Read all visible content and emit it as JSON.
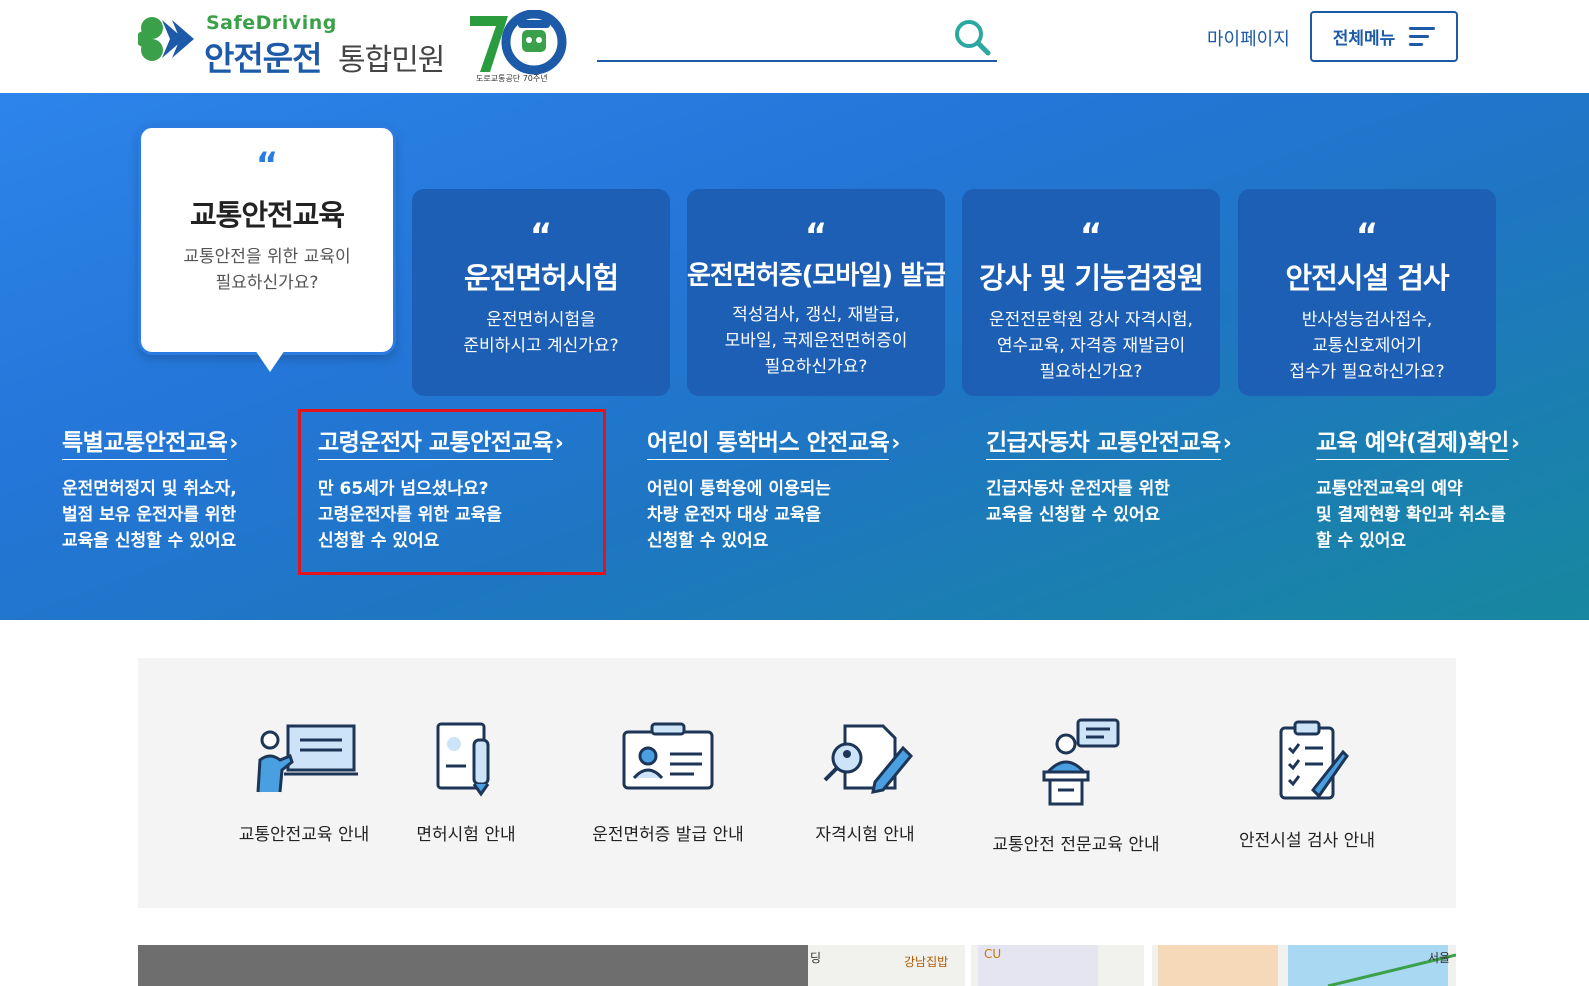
{
  "header": {
    "logo_en": "SafeDriving",
    "logo_ko_main": "안전운전",
    "logo_ko_sub": "통합민원",
    "logo_anniv_sub": "도로교통공단 70주년",
    "search_placeholder": "",
    "mypage_label": "마이페이지",
    "allmenu_label": "전체메뉴"
  },
  "hero": {
    "active_card": {
      "quote": "“",
      "title": "교통안전교육",
      "desc": "교통안전을 위한 교육이\n필요하신가요?"
    },
    "cards": [
      {
        "quote": "“",
        "title": "운전면허시험",
        "desc": "운전면허시험을\n준비하시고 계신가요?"
      },
      {
        "quote": "“",
        "title": "운전면허증(모바일) 발급",
        "desc": "적성검사, 갱신, 재발급,\n모바일, 국제운전면허증이\n필요하신가요?"
      },
      {
        "quote": "“",
        "title": "강사 및 기능검정원",
        "desc": "운전전문학원 강사 자격시험,\n연수교육, 자격증 재발급이\n필요하신가요?"
      },
      {
        "quote": "“",
        "title": "안전시설 검사",
        "desc": "반사성능검사접수,\n교통신호제어기\n접수가 필요하신가요?"
      }
    ],
    "sub_items": [
      {
        "title": "특별교통안전교육",
        "arrow": "›",
        "desc": "운전면허정지 및 취소자,\n벌점 보유 운전자를 위한\n교육을 신청할 수 있어요"
      },
      {
        "title": "고령운전자 교통안전교육",
        "arrow": "›",
        "desc": "만 65세가 넘으셨나요?\n고령운전자를 위한 교육을\n신청할 수 있어요"
      },
      {
        "title": "어린이 통학버스 안전교육",
        "arrow": "›",
        "desc": "어린이 통학용에 이용되는\n차량 운전자 대상 교육을\n신청할 수 있어요"
      },
      {
        "title": "긴급자동차 교통안전교육",
        "arrow": "›",
        "desc": "긴급자동차 운전자를 위한\n교육을 신청할 수 있어요"
      },
      {
        "title": "교육 예약(결제)확인",
        "arrow": "›",
        "desc": "교통안전교육의 예약\n및 결제현황 확인과 취소를\n할 수 있어요"
      }
    ]
  },
  "quick_links": [
    {
      "label": "교통안전교육 안내",
      "icon": "teacher-board-icon"
    },
    {
      "label": "면허시험 안내",
      "icon": "document-pen-icon"
    },
    {
      "label": "운전면허증 발급 안내",
      "icon": "id-card-icon"
    },
    {
      "label": "자격시험 안내",
      "icon": "search-document-icon"
    },
    {
      "label": "교통안전 전문교육 안내",
      "icon": "lecturer-podium-icon"
    },
    {
      "label": "안전시설 검사 안내",
      "icon": "checklist-clipboard-icon"
    }
  ],
  "map_labels": {
    "l1": "딩",
    "l2": "강남집밥",
    "l3": "CU",
    "l4": "서울"
  },
  "colors": {
    "primary": "#1d5aa8",
    "hero_top": "#2d84ea",
    "hero_bottom": "#17889f",
    "highlight": "#e3131b",
    "quote_active": "#2b7ce0"
  }
}
